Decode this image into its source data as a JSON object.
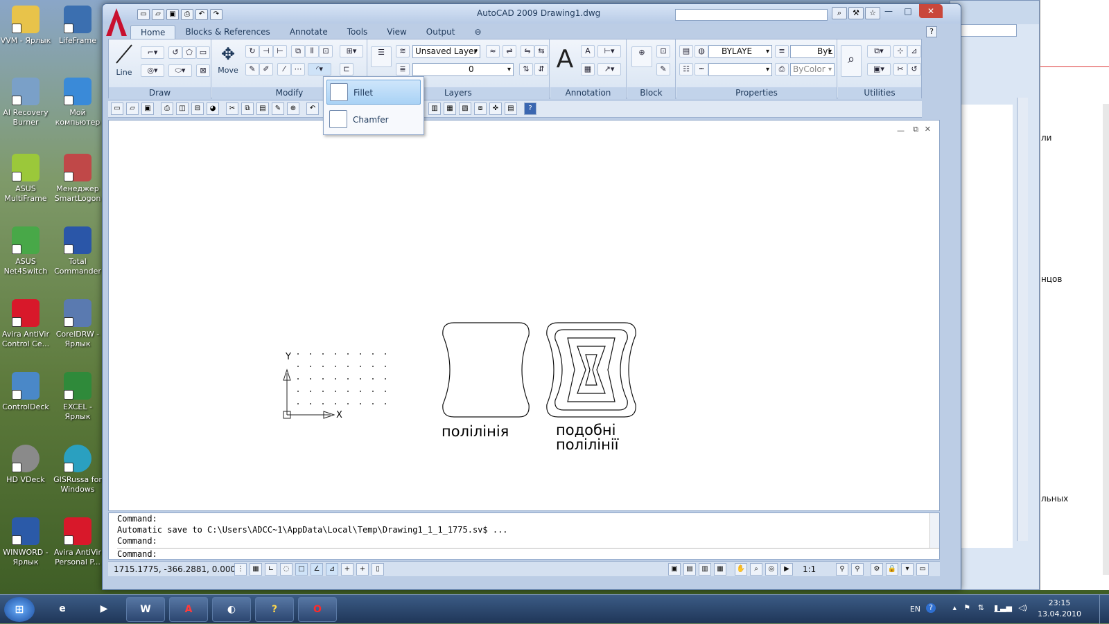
{
  "desktop_icons": [
    {
      "label": "VVM - Ярлык",
      "icon": "folder-icon"
    },
    {
      "label": "LifeFrame",
      "icon": "camera-icon"
    },
    {
      "label": "AI Recovery Burner",
      "icon": "recovery-icon"
    },
    {
      "label": "Мой компьютер",
      "icon": "computer-icon"
    },
    {
      "label": "ASUS MultiFrame",
      "icon": "grid-icon"
    },
    {
      "label": "Менеджер SmartLogon",
      "icon": "lock-icon"
    },
    {
      "label": "ASUS Net4Switch",
      "icon": "network-icon"
    },
    {
      "label": "Total Commander",
      "icon": "floppy-icon"
    },
    {
      "label": "Avira AntiVir Control Ce...",
      "icon": "umbrella-icon"
    },
    {
      "label": "CorelDRW - Ярлык",
      "icon": "corel-icon"
    },
    {
      "label": "ControlDeck",
      "icon": "control-icon"
    },
    {
      "label": "EXCEL - Ярлык",
      "icon": "excel-icon"
    },
    {
      "label": "HD VDeck",
      "icon": "disc-icon"
    },
    {
      "label": "GISRussa for Windows",
      "icon": "globe-icon"
    },
    {
      "label": "WINWORD - Ярлык",
      "icon": "word-icon"
    },
    {
      "label": "Avira AntiVir Personal P...",
      "icon": "umbrella-icon"
    }
  ],
  "app": {
    "title": "AutoCAD 2009 Drawing1.dwg",
    "logo_letter": "A"
  },
  "tabs": [
    "Home",
    "Blocks & References",
    "Annotate",
    "Tools",
    "View",
    "Output"
  ],
  "panels": {
    "draw": "Draw",
    "modify": "Modify",
    "layers": "Layers",
    "annotation": "Annotation",
    "block": "Block",
    "properties": "Properties",
    "utilities": "Utilities"
  },
  "buttons": {
    "line": "Line",
    "move": "Move"
  },
  "layers": {
    "layer_state": "Unsaved Layer",
    "current_layer": "0"
  },
  "properties": {
    "color": "BYLAYE",
    "linetype": "ByL",
    "plotstyle": "ByColor"
  },
  "dropdown": {
    "fillet": "Fillet",
    "chamfer": "Chamfer"
  },
  "canvas": {
    "label1": "полілінія",
    "label2_line1": "подобні",
    "label2_line2": "полілінії",
    "ucs_x": "X",
    "ucs_y": "Y"
  },
  "command_lines": [
    "Command:",
    "Automatic save to C:\\Users\\ADCC~1\\AppData\\Local\\Temp\\Drawing1_1_1_1775.sv$ ...",
    "Command:",
    "Command:"
  ],
  "status": {
    "coords": "1715.1775, -366.2881, 0.0000",
    "scale": "1:1"
  },
  "side_window": {
    "t1": "ли",
    "t2": "нцов",
    "t3": "льных"
  },
  "taskbar": {
    "lang": "EN",
    "time": "23:15",
    "date": "13.04.2010"
  },
  "colors": {
    "accent": "#c8102e",
    "ribbon": "#dfe8f4"
  }
}
